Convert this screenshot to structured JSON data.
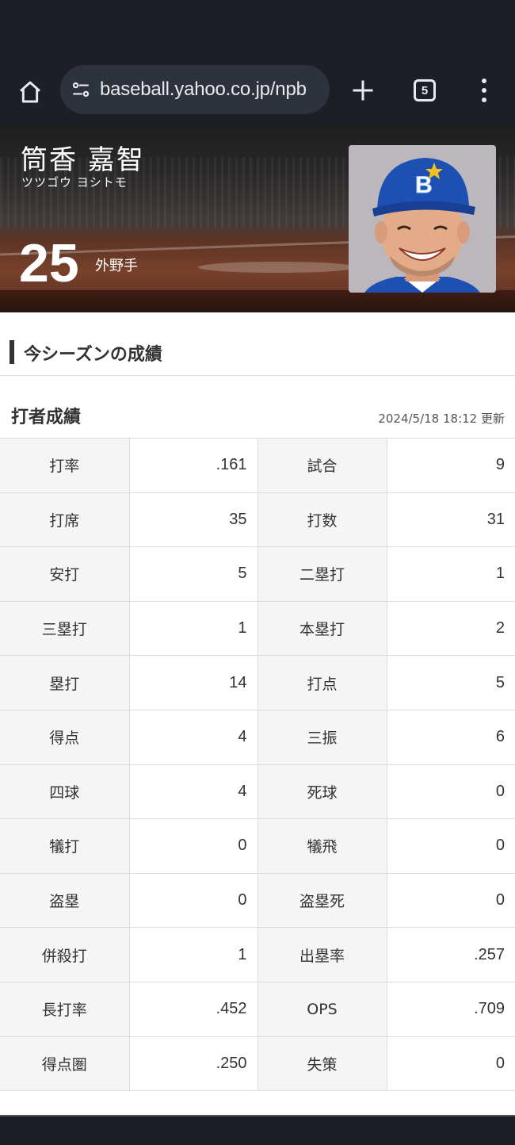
{
  "browser": {
    "url": "baseball.yahoo.co.jp/npb",
    "tab_count": "5"
  },
  "player": {
    "name": "筒香 嘉智",
    "kana": "ツツゴウ ヨシトモ",
    "number": "25",
    "position": "外野手"
  },
  "section": {
    "season_title": "今シーズンの成績",
    "batting_title": "打者成績",
    "updated": "2024/5/18 18:12 更新"
  },
  "stats": [
    {
      "l1": "打率",
      "v1": ".161",
      "l2": "試合",
      "v2": "9"
    },
    {
      "l1": "打席",
      "v1": "35",
      "l2": "打数",
      "v2": "31"
    },
    {
      "l1": "安打",
      "v1": "5",
      "l2": "二塁打",
      "v2": "1"
    },
    {
      "l1": "三塁打",
      "v1": "1",
      "l2": "本塁打",
      "v2": "2"
    },
    {
      "l1": "塁打",
      "v1": "14",
      "l2": "打点",
      "v2": "5"
    },
    {
      "l1": "得点",
      "v1": "4",
      "l2": "三振",
      "v2": "6"
    },
    {
      "l1": "四球",
      "v1": "4",
      "l2": "死球",
      "v2": "0"
    },
    {
      "l1": "犠打",
      "v1": "0",
      "l2": "犠飛",
      "v2": "0"
    },
    {
      "l1": "盗塁",
      "v1": "0",
      "l2": "盗塁死",
      "v2": "0"
    },
    {
      "l1": "併殺打",
      "v1": "1",
      "l2": "出塁率",
      "v2": ".257"
    },
    {
      "l1": "長打率",
      "v1": ".452",
      "l2": "OPS",
      "v2": ".709"
    },
    {
      "l1": "得点圏",
      "v1": ".250",
      "l2": "失策",
      "v2": "0"
    }
  ],
  "colors": {
    "chrome_bg": "#1c1f26",
    "label_bg": "#f5f5f5",
    "cap_blue": "#1e50b4"
  },
  "icons": [
    "home-icon",
    "tune-icon",
    "plus-icon",
    "tab-switcher-icon",
    "more-vert-icon"
  ]
}
